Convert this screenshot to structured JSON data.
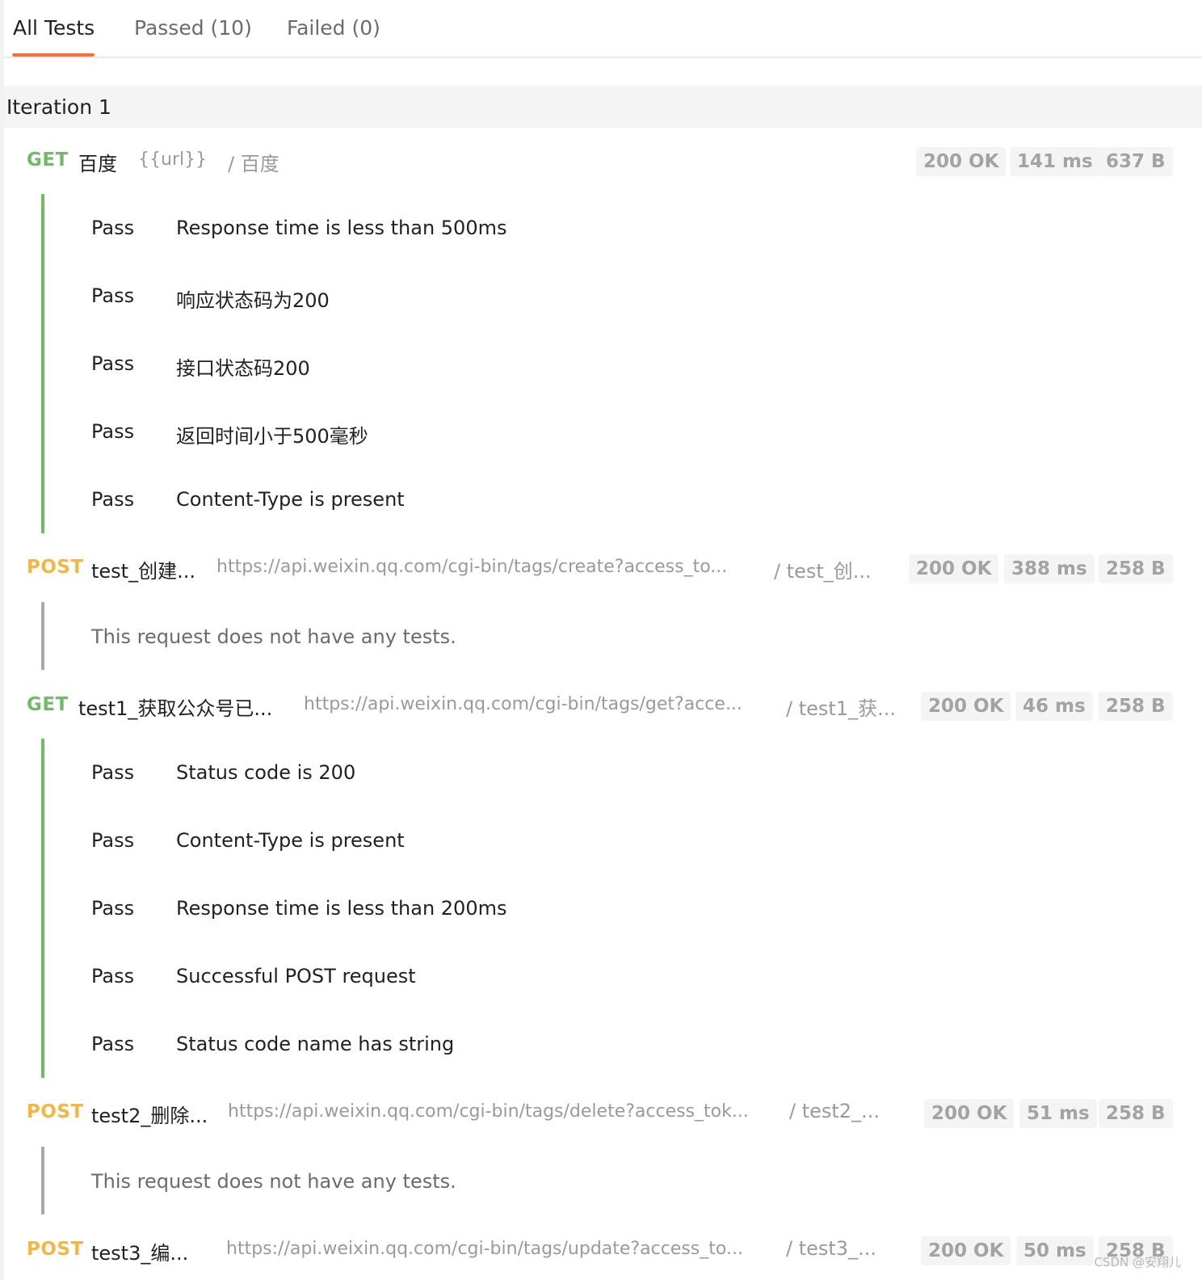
{
  "tabs": [
    {
      "label": "All Tests",
      "active": true
    },
    {
      "label": "Passed (10)",
      "active": false
    },
    {
      "label": "Failed (0)",
      "active": false
    }
  ],
  "iteration": {
    "label": "Iteration 1"
  },
  "requests": [
    {
      "method": "GET",
      "name": "百度",
      "url": "{{url}}",
      "path": "/ 百度",
      "status": "200 OK",
      "time": "141 ms",
      "size": "637 B",
      "tests": [
        {
          "status": "Pass",
          "name": "Response time is less than 500ms"
        },
        {
          "status": "Pass",
          "name": "响应状态码为200"
        },
        {
          "status": "Pass",
          "name": "接口状态码200"
        },
        {
          "status": "Pass",
          "name": "返回时间小于500毫秒"
        },
        {
          "status": "Pass",
          "name": "Content-Type is present"
        }
      ]
    },
    {
      "method": "POST",
      "name": "test_创建...",
      "url": "https://api.weixin.qq.com/cgi-bin/tags/create?access_to...",
      "path": "/ test_创...",
      "status": "200 OK",
      "time": "388 ms",
      "size": "258 B",
      "no_tests": "This request does not have any tests."
    },
    {
      "method": "GET",
      "name": "test1_获取公众号已...",
      "url": "https://api.weixin.qq.com/cgi-bin/tags/get?acce...",
      "path": "/ test1_获...",
      "status": "200 OK",
      "time": "46 ms",
      "size": "258 B",
      "tests": [
        {
          "status": "Pass",
          "name": "Status code is 200"
        },
        {
          "status": "Pass",
          "name": "Content-Type is present"
        },
        {
          "status": "Pass",
          "name": "Response time is less than 200ms"
        },
        {
          "status": "Pass",
          "name": "Successful POST request"
        },
        {
          "status": "Pass",
          "name": "Status code name has string"
        }
      ]
    },
    {
      "method": "POST",
      "name": "test2_删除...",
      "url": "https://api.weixin.qq.com/cgi-bin/tags/delete?access_tok...",
      "path": "/ test2_...",
      "status": "200 OK",
      "time": "51 ms",
      "size": "258 B",
      "no_tests": "This request does not have any tests."
    },
    {
      "method": "POST",
      "name": "test3_编...",
      "url": "https://api.weixin.qq.com/cgi-bin/tags/update?access_to...",
      "path": "/ test3_...",
      "status": "200 OK",
      "time": "50 ms",
      "size": "258 B"
    }
  ],
  "watermark": "CSDN @安翔儿",
  "colors": {
    "accent": "#ff6c37",
    "get": "#74b76d",
    "post": "#f5b544",
    "pass_bar": "#6cbf61",
    "none_bar": "#a9a9a9"
  }
}
